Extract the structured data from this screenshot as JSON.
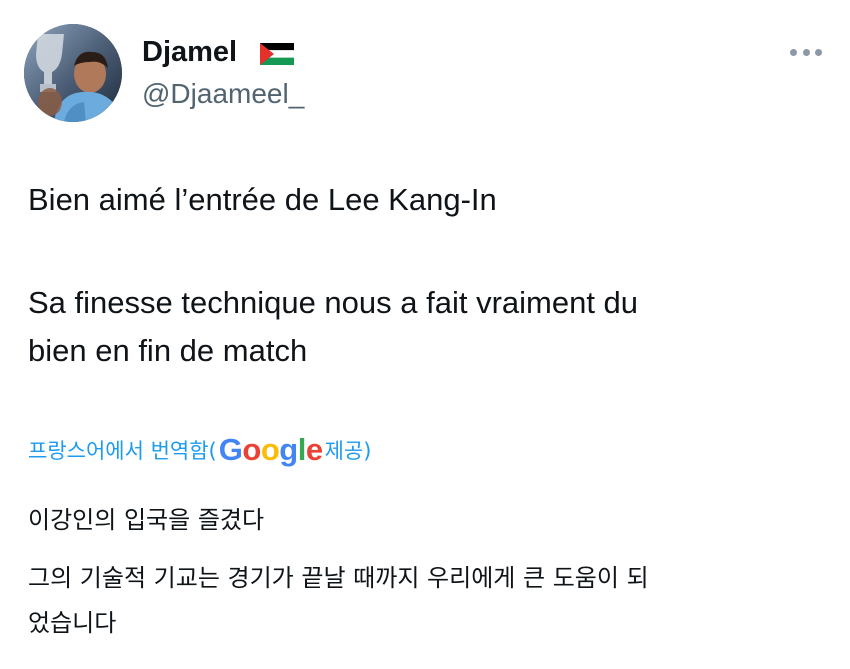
{
  "author": {
    "display_name": "Djamel",
    "handle": "@Djaameel_",
    "flag_icon": "palestine-flag-icon"
  },
  "menu": {
    "icon": "more-horizontal-icon"
  },
  "tweet": {
    "lines": [
      "Bien aimé l’entrée de Lee Kang-In",
      "Sa finesse technique nous a fait vraiment du",
      "bien en fin de match"
    ]
  },
  "translation": {
    "prefix": "프랑스어에서 번역함(",
    "provider_letters": [
      "G",
      "o",
      "o",
      "g",
      "l",
      "e"
    ],
    "suffix": " 제공)",
    "link_color": "#1d9bf0",
    "lines": [
      "이강인의 입국을 즐겼다",
      "그의 기술적 기교는 경기가 끝날 때까지 우리에게 큰 도움이 되",
      "었습니다"
    ]
  },
  "colors": {
    "text_primary": "#0f1419",
    "text_secondary": "#536471",
    "accent": "#1d9bf0"
  }
}
